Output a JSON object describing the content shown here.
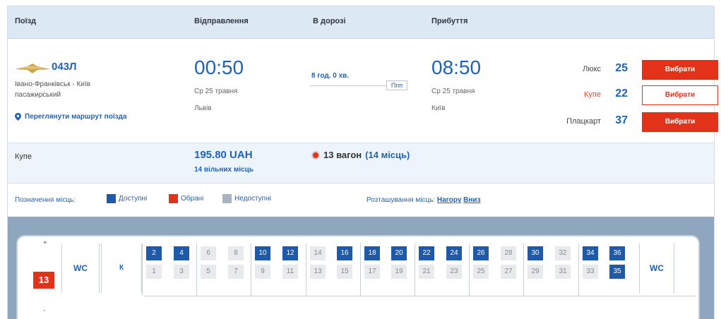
{
  "header": {
    "col_train": "Поїзд",
    "col_departure": "Відправлення",
    "col_duration": "В дорозі",
    "col_arrival": "Прибуття"
  },
  "train": {
    "number": "043Л",
    "route_line1": "Івано-Франківськ - Київ",
    "route_line2": "пасажирський",
    "route_link": "Переглянути маршрут поїзда",
    "departure": {
      "time": "00:50",
      "date": "Ср 25 травня",
      "station": "Львів"
    },
    "duration": {
      "text": "8 год. 0 хв.",
      "badge": "Ппп"
    },
    "arrival": {
      "time": "08:50",
      "date": "Ср 25 травня",
      "station": "Київ"
    },
    "classes": [
      {
        "name": "Люкс",
        "count": "25",
        "button": "Вибрати",
        "selected": false
      },
      {
        "name": "Купе",
        "count": "22",
        "button": "Вибрати",
        "selected": true
      },
      {
        "name": "Плацкарт",
        "count": "37",
        "button": "Вибрати",
        "selected": false
      }
    ]
  },
  "coupe": {
    "label": "Купе",
    "price": "195.80 UAH",
    "free_places": "14 вільних місць",
    "wagon_number": "13 вагон",
    "wagon_seats": "(14 місць)"
  },
  "legend": {
    "title": "Позначення місць:",
    "available": "Доступні",
    "selected": "Обрані",
    "unavailable": "Недоступні",
    "sort_label": "Розташування місць:",
    "sort_up": "Нагору",
    "sort_down": "Вниз",
    "colors": {
      "available": "#1e5aa8",
      "selected": "#e2321a",
      "unavailable": "#a9b4c2"
    }
  },
  "car_map": {
    "car_number": "13",
    "edge_top": "+",
    "edge_bottom": "-",
    "wc_left": "WC",
    "wc_right": "WC",
    "service_label": "К",
    "top_row": [
      "2",
      "4",
      "6",
      "8",
      "10",
      "12",
      "14",
      "16",
      "18",
      "20",
      "22",
      "24",
      "26",
      "28",
      "30",
      "32",
      "34",
      "36"
    ],
    "top_available": [
      true,
      true,
      false,
      false,
      true,
      true,
      false,
      true,
      true,
      true,
      true,
      true,
      true,
      false,
      true,
      false,
      true,
      true
    ],
    "bottom_row": [
      "1",
      "3",
      "5",
      "7",
      "9",
      "11",
      "13",
      "15",
      "17",
      "19",
      "21",
      "23",
      "25",
      "27",
      "29",
      "31",
      "33",
      "35"
    ],
    "bottom_available": [
      false,
      false,
      false,
      false,
      false,
      false,
      false,
      false,
      false,
      false,
      false,
      false,
      false,
      false,
      false,
      false,
      false,
      true
    ]
  }
}
